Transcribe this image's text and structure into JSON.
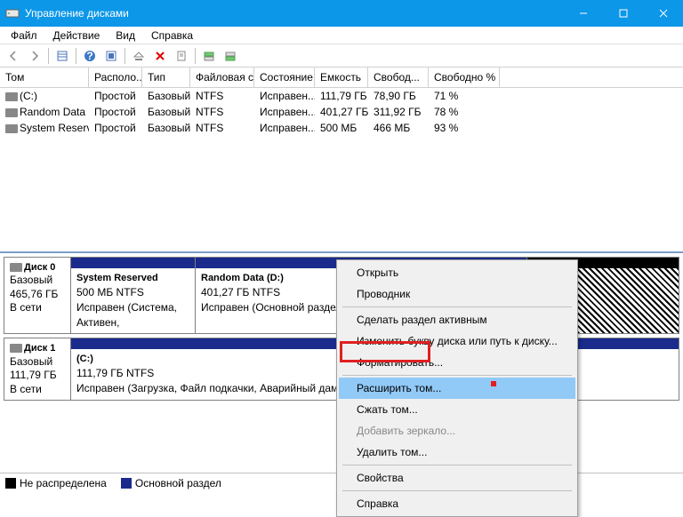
{
  "title": "Управление дисками",
  "menu": {
    "file": "Файл",
    "action": "Действие",
    "view": "Вид",
    "help": "Справка"
  },
  "columns": {
    "vol": "Том",
    "layout": "Располо...",
    "type": "Тип",
    "fs": "Файловая с...",
    "state": "Состояние",
    "cap": "Емкость",
    "free": "Свобод...",
    "pct": "Свободно %"
  },
  "volumes": [
    {
      "vol": "(C:)",
      "layout": "Простой",
      "type": "Базовый",
      "fs": "NTFS",
      "state": "Исправен...",
      "cap": "111,79 ГБ",
      "free": "78,90 ГБ",
      "pct": "71 %"
    },
    {
      "vol": "Random Data (D:)",
      "layout": "Простой",
      "type": "Базовый",
      "fs": "NTFS",
      "state": "Исправен...",
      "cap": "401,27 ГБ",
      "free": "311,92 ГБ",
      "pct": "78 %"
    },
    {
      "vol": "System Reserved",
      "layout": "Простой",
      "type": "Базовый",
      "fs": "NTFS",
      "state": "Исправен...",
      "cap": "500 МБ",
      "free": "466 МБ",
      "pct": "93 %"
    }
  ],
  "disk0": {
    "name": "Диск 0",
    "type": "Базовый",
    "size": "465,76 ГБ",
    "status": "В сети",
    "p1": {
      "title": "System Reserved",
      "sub": "500 МБ NTFS",
      "state": "Исправен (Система, Активен,"
    },
    "p2": {
      "title": "Random Data  (D:)",
      "sub": "401,27 ГБ NTFS",
      "state": "Исправен (Основной раздел)"
    }
  },
  "disk1": {
    "name": "Диск 1",
    "type": "Базовый",
    "size": "111,79 ГБ",
    "status": "В сети",
    "p1": {
      "title": "(C:)",
      "sub": "111,79 ГБ NTFS",
      "state": "Исправен (Загрузка, Файл подкачки, Аварийный дамп памяти, Ос"
    }
  },
  "legend": {
    "unalloc": "Не распределена",
    "primary": "Основной раздел"
  },
  "ctx": {
    "open": "Открыть",
    "explorer": "Проводник",
    "active": "Сделать раздел активным",
    "letter": "Изменить букву диска или путь к диску...",
    "format": "Форматировать...",
    "extend": "Расширить том...",
    "shrink": "Сжать том...",
    "mirror": "Добавить зеркало...",
    "delete": "Удалить том...",
    "props": "Свойства",
    "help": "Справка"
  }
}
